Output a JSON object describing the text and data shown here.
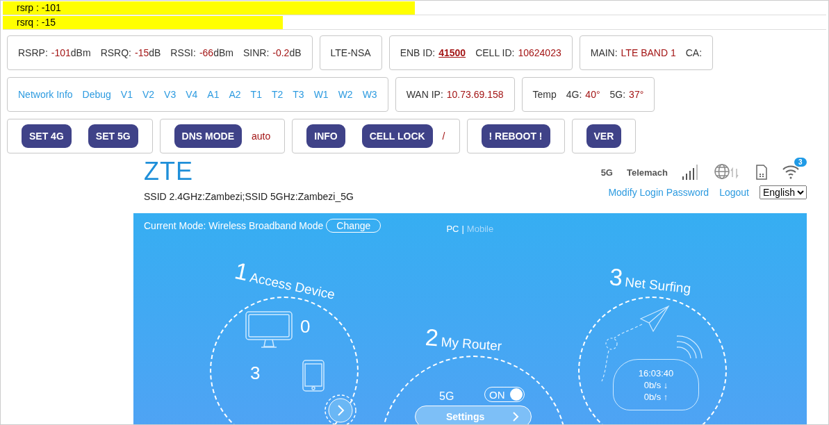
{
  "signal_bars": [
    {
      "label": "rsrp : -101",
      "level": 0.5
    },
    {
      "label": "rsrq : -15",
      "level": 0.34
    }
  ],
  "info_row": [
    {
      "items": [
        {
          "kind": "reading",
          "label": "RSRP:",
          "value": "-101",
          "unit": "dBm"
        },
        {
          "kind": "reading",
          "label": "RSRQ:",
          "value": "-15",
          "unit": "dB"
        },
        {
          "kind": "reading",
          "label": "RSSI:",
          "value": "-66",
          "unit": "dBm"
        },
        {
          "kind": "reading",
          "label": "SINR:",
          "value": "-0.2",
          "unit": "dB"
        }
      ]
    },
    {
      "items": [
        {
          "kind": "plain",
          "label": "LTE-NSA"
        }
      ]
    },
    {
      "items": [
        {
          "kind": "link",
          "label": "ENB ID:",
          "value": "41500"
        },
        {
          "kind": "reading",
          "label": "CELL ID:",
          "value": "10624023"
        }
      ]
    },
    {
      "items": [
        {
          "kind": "reading",
          "label": "MAIN:",
          "value": "LTE BAND 1"
        },
        {
          "kind": "plain",
          "label": "CA:"
        }
      ]
    }
  ],
  "nav_links": [
    "Network Info",
    "Debug",
    "V1",
    "V2",
    "V3",
    "V4",
    "A1",
    "A2",
    "T1",
    "T2",
    "T3",
    "W1",
    "W2",
    "W3"
  ],
  "status_row": [
    {
      "items": [
        {
          "kind": "reading",
          "label": "WAN IP:",
          "value": "10.73.69.158"
        }
      ]
    },
    {
      "items": [
        {
          "kind": "plain",
          "label": "Temp"
        },
        {
          "kind": "reading",
          "label": "4G:",
          "value": "40°"
        },
        {
          "kind": "reading",
          "label": "5G:",
          "value": "37°"
        }
      ]
    }
  ],
  "button_groups": [
    {
      "buttons": [
        "SET 4G",
        "SET 5G"
      ]
    },
    {
      "buttons": [
        "DNS MODE"
      ],
      "note": "auto"
    },
    {
      "buttons": [
        "INFO",
        "CELL LOCK"
      ],
      "note": "/"
    },
    {
      "buttons": [
        "! REBOOT !"
      ]
    },
    {
      "buttons": [
        "VER"
      ]
    }
  ],
  "router": {
    "logo": "ZTE",
    "ssid": "SSID 2.4GHz:Zambezi;SSID 5GHz:Zambezi_5G",
    "network_type": "5G",
    "operator": "Telemach",
    "wifi_clients": "3",
    "links": [
      "Modify Login Password",
      "Logout"
    ],
    "language": "English",
    "mode_label": "Current Mode: Wireless Broadband Mode",
    "change_button": "Change",
    "views": [
      {
        "label": "PC",
        "selected": true
      },
      {
        "label": "Mobile",
        "selected": false
      }
    ],
    "view_separator": "|",
    "access": {
      "number": "1",
      "title": "Access Device",
      "wired_count": "0",
      "wireless_count": "3"
    },
    "my_router": {
      "number": "2",
      "title": "My Router",
      "band": "5G",
      "on": true,
      "toggle_label": "ON",
      "settings_button": "Settings"
    },
    "surfing": {
      "number": "3",
      "title": "Net Surfing",
      "time": "16:03:40",
      "download": "0b/s ↓",
      "upload": "0b/s ↑"
    }
  }
}
